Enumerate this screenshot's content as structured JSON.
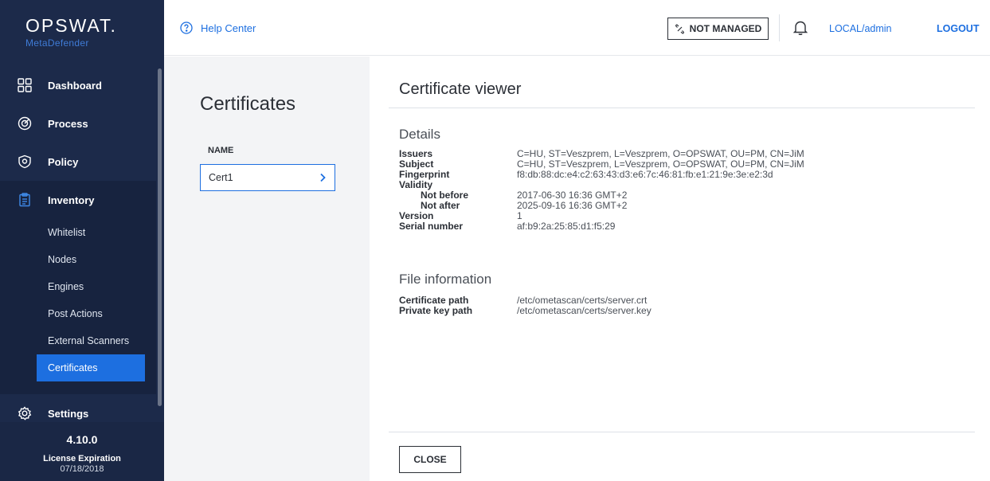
{
  "brand": {
    "logo": "OPSWAT.",
    "product": "MetaDefender"
  },
  "sidebar": {
    "items": [
      {
        "label": "Dashboard",
        "icon": "grid-icon"
      },
      {
        "label": "Process",
        "icon": "target-icon"
      },
      {
        "label": "Policy",
        "icon": "shield-icon"
      },
      {
        "label": "Inventory",
        "icon": "clipboard-icon"
      },
      {
        "label": "Settings",
        "icon": "gear-icon"
      }
    ],
    "inventory_sub": [
      "Whitelist",
      "Nodes",
      "Engines",
      "Post Actions",
      "External Scanners",
      "Certificates"
    ],
    "selected_sub": "Certificates",
    "version": "4.10.0",
    "license_label": "License Expiration",
    "license_date": "07/18/2018"
  },
  "topbar": {
    "help_label": "Help Center",
    "not_managed_label": "NOT MANAGED",
    "user_label": "LOCAL/admin",
    "logout_label": "LOGOUT"
  },
  "list": {
    "title": "Certificates",
    "column_header": "NAME",
    "rows": [
      "Cert1"
    ]
  },
  "viewer": {
    "title": "Certificate viewer",
    "details_title": "Details",
    "details": {
      "issuers_label": "Issuers",
      "issuers": "C=HU, ST=Veszprem, L=Veszprem, O=OPSWAT, OU=PM, CN=JiM",
      "subject_label": "Subject",
      "subject": "C=HU, ST=Veszprem, L=Veszprem, O=OPSWAT, OU=PM, CN=JiM",
      "fingerprint_label": "Fingerprint",
      "fingerprint": "f8:db:88:dc:e4:c2:63:43:d3:e6:7c:46:81:fb:e1:21:9e:3e:e2:3d",
      "validity_label": "Validity",
      "not_before_label": "Not before",
      "not_before": "2017-06-30 16:36 GMT+2",
      "not_after_label": "Not after",
      "not_after": "2025-09-16 16:36 GMT+2",
      "version_label": "Version",
      "version": "1",
      "serial_label": "Serial number",
      "serial": "af:b9:2a:25:85:d1:f5:29"
    },
    "file_title": "File information",
    "file": {
      "cert_path_label": "Certificate path",
      "cert_path": "/etc/ometascan/certs/server.crt",
      "key_path_label": "Private key path",
      "key_path": "/etc/ometascan/certs/server.key"
    },
    "close_label": "CLOSE"
  },
  "colors": {
    "sidebar_bg": "#1c2a4a",
    "accent": "#1d6fe0",
    "list_bg": "#f3f4f6"
  }
}
